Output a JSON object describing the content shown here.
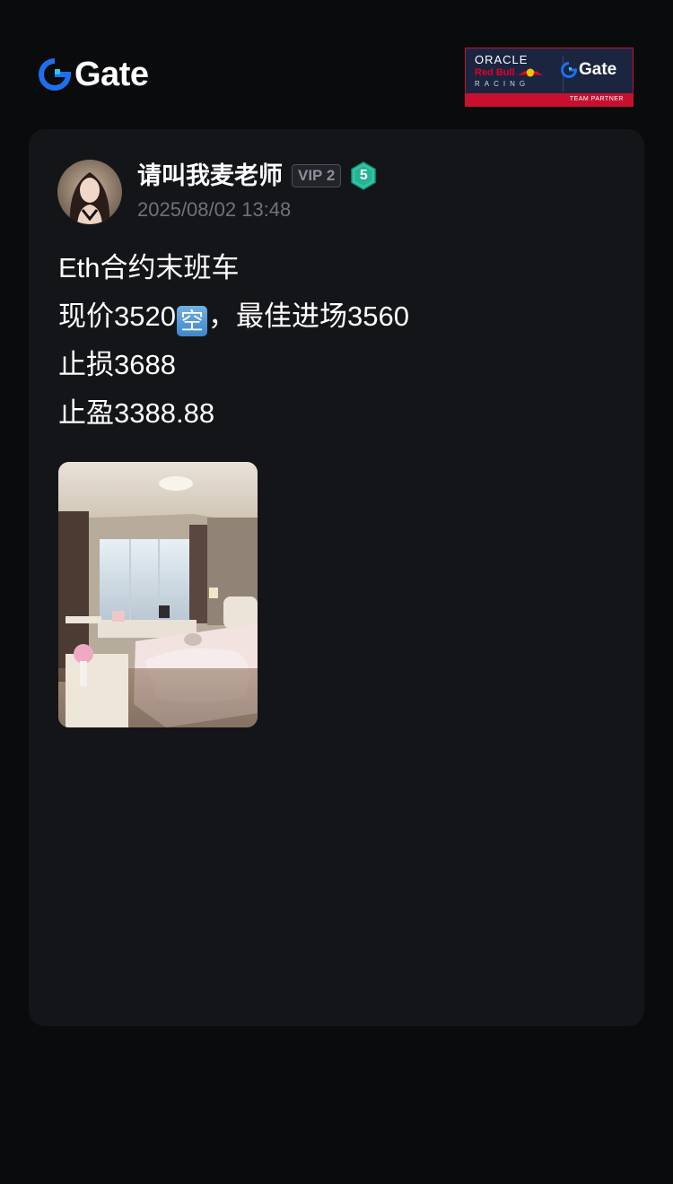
{
  "header": {
    "brand_name": "Gate",
    "partner": {
      "oracle": "ORACLE",
      "red_bull": "Red Bull",
      "racing": "RACING",
      "gate": "Gate",
      "footer": "TEAM PARTNER"
    }
  },
  "post": {
    "author": {
      "name": "请叫我麦老师",
      "vip": "VIP 2",
      "level": "5"
    },
    "timestamp": "2025/08/02 13:48",
    "lines": {
      "l1": "Eth合约末班车",
      "l2_before": "现价3520",
      "l2_emoji": "空",
      "l2_after": "，最佳进场3560",
      "l3": "止损3688",
      "l4": "止盈3388.88"
    }
  },
  "colors": {
    "background": "#0a0b0c",
    "card": "#141518",
    "brand_blue": "#1e6ff0",
    "brand_cyan": "#29c6e6",
    "level_green": "#2ec7a4",
    "redbull_red": "#c8102e"
  },
  "icons": {
    "brand": "gate-logo-icon",
    "level": "hexagon-level-icon"
  }
}
